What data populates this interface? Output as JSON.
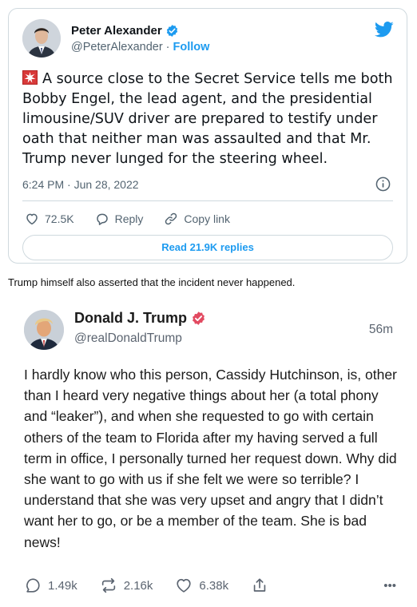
{
  "tweet1": {
    "author_name": "Peter Alexander",
    "author_handle": "@PeterAlexander",
    "separator": "·",
    "follow_label": "Follow",
    "text": "A source close to the Secret Service tells me both Bobby Engel, the lead agent, and the presidential limousine/SUV driver are prepared to testify under oath that neither man was assaulted and that Mr. Trump never lunged for the steering wheel.",
    "timestamp": "6:24 PM · Jun 28, 2022",
    "likes": "72.5K",
    "reply_label": "Reply",
    "copy_link_label": "Copy link",
    "read_replies_label": "Read 21.9K replies",
    "icons": [
      "verified-badge-icon",
      "twitter-bird-icon",
      "siren-emoji-icon",
      "info-icon",
      "heart-icon",
      "reply-icon",
      "link-icon"
    ],
    "colors": {
      "accent": "#1d9bf0",
      "secondary_text": "#536471",
      "border": "#cfd9de"
    }
  },
  "caption": "Trump himself also asserted that the incident never happened.",
  "tweet2": {
    "author_name": "Donald J. Trump",
    "author_handle": "@realDonaldTrump",
    "time_ago": "56m",
    "text": "I hardly know who this person, Cassidy Hutchinson, is, other than I heard very negative things about her (a total phony and “leaker”), and when she requested to go with certain others of the team to Florida after my having served a full term in office, I personally turned her request down. Why did she want to go with us if she felt we were so terrible? I understand that she was very upset and angry that I didn’t want her to go, or be a member of the team. She is bad news!",
    "replies": "1.49k",
    "retruths": "2.16k",
    "likes": "6.38k",
    "more_label": "•••",
    "icons": [
      "verified-badge-icon",
      "reply-bubble-icon",
      "retruth-icon",
      "heart-icon",
      "share-icon",
      "more-icon"
    ],
    "colors": {
      "verified": "#e24a61",
      "secondary_text": "#5b6470"
    }
  }
}
